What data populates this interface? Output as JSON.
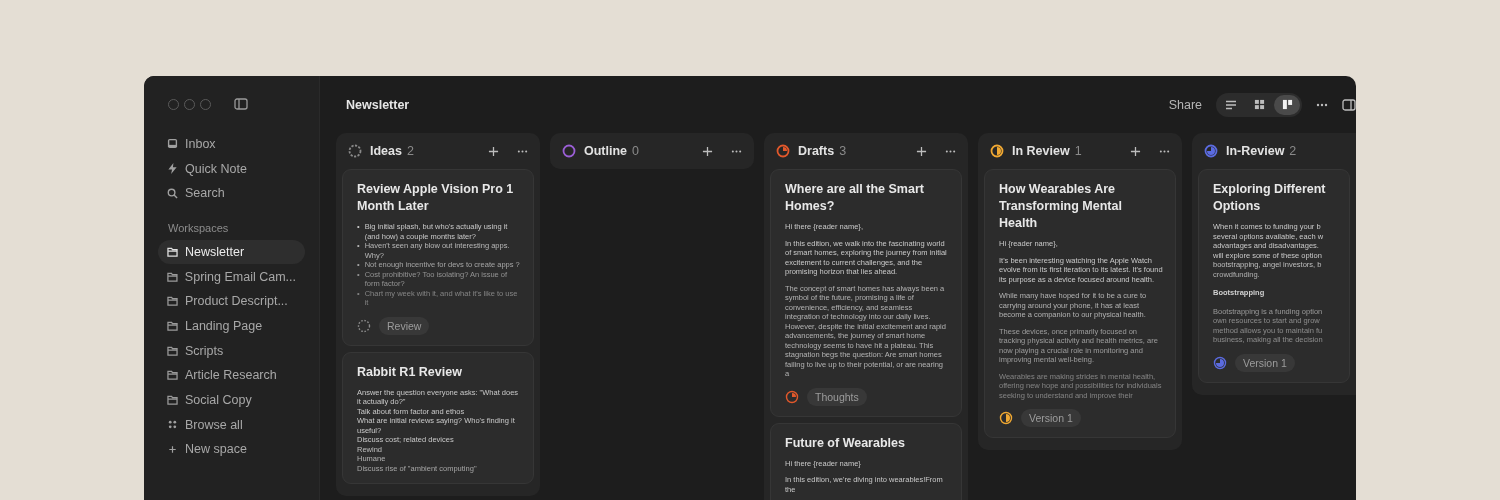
{
  "sidebar": {
    "nav": [
      {
        "kind": "inbox",
        "label": "Inbox"
      },
      {
        "kind": "bolt",
        "label": "Quick Note"
      },
      {
        "kind": "search",
        "label": "Search"
      }
    ],
    "section_title": "Workspaces",
    "workspaces": [
      {
        "label": "Newsletter",
        "selected": true
      },
      {
        "label": "Spring Email Cam...",
        "selected": false
      },
      {
        "label": "Product Descript...",
        "selected": false
      },
      {
        "label": "Landing Page",
        "selected": false
      },
      {
        "label": "Scripts",
        "selected": false
      },
      {
        "label": "Article Research",
        "selected": false
      },
      {
        "label": "Social Copy",
        "selected": false
      }
    ],
    "footer": [
      {
        "kind": "dots",
        "label": "Browse all"
      },
      {
        "kind": "plus",
        "label": "New space"
      }
    ]
  },
  "header": {
    "title": "Newsletter",
    "share": "Share",
    "views": [
      {
        "kind": "list",
        "selected": false
      },
      {
        "kind": "grid",
        "selected": false
      },
      {
        "kind": "board",
        "selected": true
      }
    ]
  },
  "columns": [
    {
      "title": "Ideas",
      "count": "2",
      "kind": "dashed",
      "color": "#8a8a8a",
      "cards": [
        {
          "title": "Review Apple Vision Pro 1 Month Later",
          "body": [
            {
              "kind": "bullets",
              "marker": "•",
              "items": [
                "Big initial splash, but who's actually using it (and how) a couple months later?",
                "Haven't seen any blow out interesting apps. Why?",
                "Not enough incentive for devs to create apps ?",
                "Cost prohibitive? Too isolating? An issue of form factor?",
                "Chart my week with it, and what it's like to use it"
              ]
            }
          ],
          "tag": "Review"
        },
        {
          "title": "Rabbit R1 Review",
          "body": [
            {
              "kind": "line",
              "text": "Answer the question everyone asks: \"What does it actually do?\""
            },
            {
              "kind": "line",
              "text": "Talk about form factor and ethos"
            },
            {
              "kind": "line",
              "text": "What are initial reviews saying? Who's finding it useful?"
            },
            {
              "kind": "line",
              "text": "Discuss cost; related devices"
            },
            {
              "kind": "line",
              "text": "Rewind"
            },
            {
              "kind": "line",
              "text": "Humane"
            },
            {
              "kind": "line",
              "text": "Discuss rise of \"ambient computing\""
            }
          ]
        }
      ]
    },
    {
      "title": "Outline",
      "count": "0",
      "kind": "empty",
      "color": "#9b5fd6"
    },
    {
      "title": "Drafts",
      "count": "3",
      "kind": "quarter",
      "color": "#e2582b",
      "cards": [
        {
          "title": "Where are all the Smart Homes?",
          "body": [
            {
              "kind": "para",
              "text": "Hi there {reader name},"
            },
            {
              "kind": "para",
              "text": "In this edition, we walk into the fascinating world of smart homes, exploring the journey from initial excitement to current challenges, and the promising horizon that lies ahead."
            },
            {
              "kind": "para",
              "text": "The concept of smart homes has always been a symbol of the future, promising a life of convenience, efficiency, and seamless integration of technology into our daily lives. However, despite the initial excitement and rapid advancements, the journey of smart home technology seems to have hit a plateau. This stagnation begs the question: Are smart homes failing to live up to their potential, or are nearing a"
            }
          ],
          "tag": "Thoughts"
        },
        {
          "title": "Future of Wearables",
          "body": [
            {
              "kind": "para",
              "text": "Hi there {reader name}"
            },
            {
              "kind": "para",
              "text": "In this edition, we're diving into wearables!From the"
            }
          ]
        }
      ]
    },
    {
      "title": "In Review",
      "count": "1",
      "kind": "half",
      "color": "#f0a832",
      "cards": [
        {
          "title": "How Wearables Are Transforming Mental Health",
          "body": [
            {
              "kind": "para",
              "text": "Hi {reader name},"
            },
            {
              "kind": "para",
              "text": "It's been interesting watching the Apple Watch evolve from its first iteration to its latest. It's found its purpose as a device focused around health."
            },
            {
              "kind": "para",
              "text": "While many have hoped for it to be a cure to carrying around your phone, it has at least become a companion to our physical health."
            },
            {
              "kind": "para",
              "text": "These devices, once primarily focused on tracking physical activity and health metrics, are now playing a crucial role in monitoring and improving mental well-being."
            },
            {
              "kind": "para",
              "text": "Wearables are making strides in mental health, offering new hope and possibilities for individuals seeking to understand and improve their"
            }
          ],
          "tag": "Version 1"
        }
      ]
    },
    {
      "title": "In-Review",
      "count": "2",
      "kind": "threequarter",
      "color": "#5b6be0",
      "cards": [
        {
          "title": "Exploring Different Options",
          "body": [
            {
              "kind": "line",
              "text": "When it comes to funding your b"
            },
            {
              "kind": "line",
              "text": "several options available, each w"
            },
            {
              "kind": "line",
              "text": "advantages and disadvantages."
            },
            {
              "kind": "line",
              "text": "will explore some of these option"
            },
            {
              "kind": "line",
              "text": "bootstrapping, angel investors, b"
            },
            {
              "kind": "line",
              "text": "crowdfunding."
            },
            {
              "kind": "heading",
              "text": "Bootstrapping"
            },
            {
              "kind": "line",
              "text": "Bootstrapping is a funding option"
            },
            {
              "kind": "line",
              "text": "own resources to start and grow"
            },
            {
              "kind": "line",
              "text": "method allows you to maintain fu"
            },
            {
              "kind": "line",
              "text": "business, making all the decision"
            }
          ],
          "tag": "Version 1"
        }
      ]
    }
  ]
}
